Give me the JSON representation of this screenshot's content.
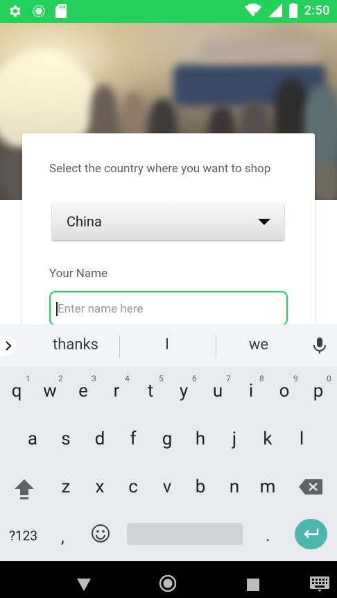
{
  "status_bar": {
    "time": "2:50",
    "bg_color": "#22d05a",
    "left_icons": [
      "gear-icon",
      "circle-app-icon",
      "sd-card-icon"
    ],
    "right_icons": [
      "wifi-icon",
      "signal-icon",
      "battery-icon"
    ]
  },
  "card": {
    "country_label": "Select the country where you want to shop",
    "country_value": "China",
    "name_label": "Your Name",
    "name_placeholder": "Enter name here",
    "accent_color": "#22d05a"
  },
  "keyboard": {
    "suggestions": [
      "thanks",
      "I",
      "we"
    ],
    "row1": [
      "q",
      "w",
      "e",
      "r",
      "t",
      "y",
      "u",
      "i",
      "o",
      "p"
    ],
    "row1_hints": [
      "1",
      "2",
      "3",
      "4",
      "5",
      "6",
      "7",
      "8",
      "9",
      "0"
    ],
    "row2": [
      "a",
      "s",
      "d",
      "f",
      "g",
      "h",
      "j",
      "k",
      "l"
    ],
    "row3": [
      "z",
      "x",
      "c",
      "v",
      "b",
      "n",
      "m"
    ],
    "symbols_label": "?123",
    "comma": ",",
    "period": ".",
    "enter_color": "#4db6ac"
  },
  "nav_bar": {
    "buttons": [
      "back-icon",
      "home-icon",
      "recents-icon",
      "keyboard-switch-icon"
    ]
  }
}
